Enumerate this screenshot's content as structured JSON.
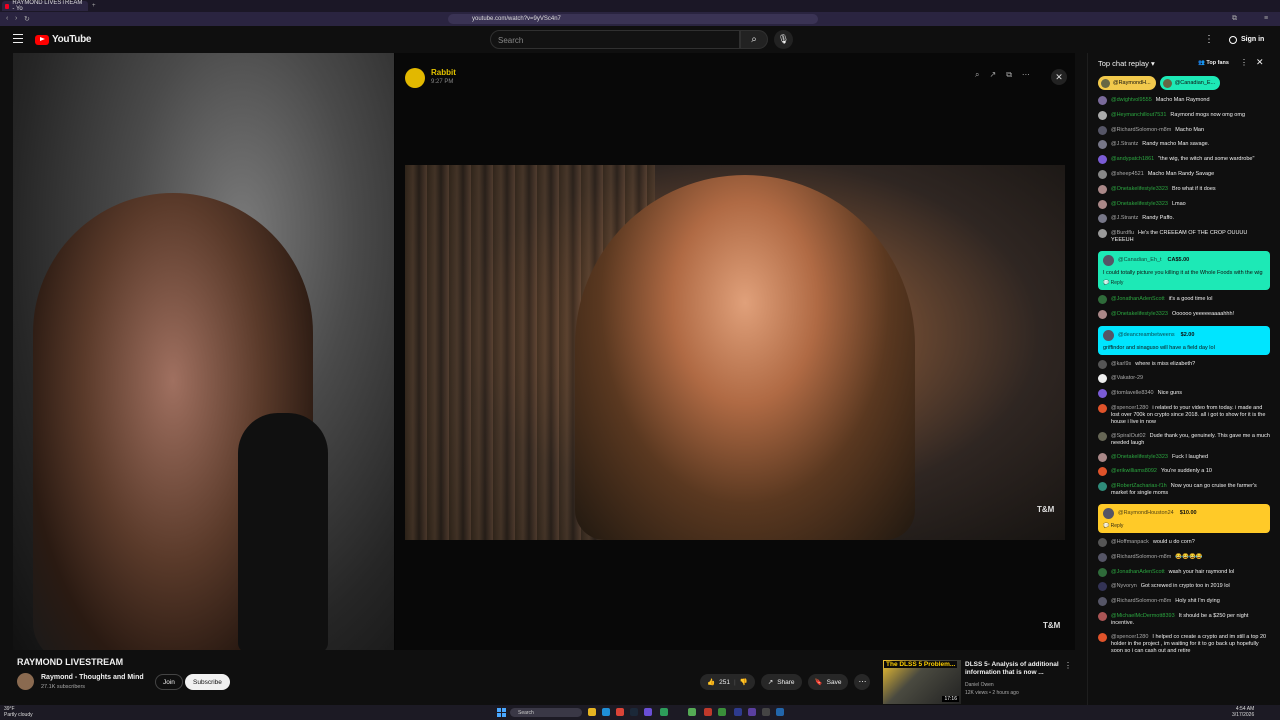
{
  "browser": {
    "tab_title": "RAYMOND LIVESTREAM - Yo",
    "url": "youtube.com/watch?v=9yVSc4n7"
  },
  "header": {
    "logo_text": "YouTube",
    "search_placeholder": "Search",
    "signin_label": "Sign in"
  },
  "inner_video": {
    "channel": "Rabbit",
    "time": "9:27 PM",
    "watermark": "T&M"
  },
  "video": {
    "title": "RAYMOND LIVESTREAM",
    "channel": "Raymond - Thoughts and Mind",
    "subscribers": "27.1K subscribers",
    "join_label": "Join",
    "subscribe_label": "Subscribe",
    "likes": "251",
    "share_label": "Share",
    "save_label": "Save"
  },
  "recommended": {
    "thumb_text": "The DLSS 5 Problem...",
    "duration": "17:16",
    "title": "DLSS 5- Analysis of additional information that is now ...",
    "channel": "Daniel Owen",
    "meta": "12K views • 2 hours ago"
  },
  "chat": {
    "title": "Top chat replay",
    "top_fans": "Top fans",
    "pinned": [
      {
        "label": "@RaymondH...",
        "color": "#f2c94c"
      },
      {
        "label": "@Canadian_E...",
        "color": "#1de9b6"
      }
    ],
    "messages": [
      {
        "author": "@dwightvol9555",
        "text": "Macho Man Raymond",
        "color": "#7a6a9a"
      },
      {
        "author": "@Heymanchillout7531",
        "text": "Raymond mogs now omg omg",
        "color": "#aaa"
      },
      {
        "author": "@RichardSolomon-m8m",
        "text": "Macho Man",
        "color": "#556",
        "gray": true
      },
      {
        "author": "@J.Strantz",
        "text": "Randy macho Man savage.",
        "color": "#778",
        "gray": true
      },
      {
        "author": "@andypatch1861",
        "text": "\"the wig, the witch and some wardrobe\"",
        "color": "#7b5cd6"
      },
      {
        "author": "@sheep4521",
        "text": "Macho Man Randy Savage",
        "color": "#888",
        "gray": true
      },
      {
        "author": "@Onetakelifestyle3323",
        "text": "Bro what if it does",
        "color": "#a88",
        "gray": false
      },
      {
        "author": "@Onetakelifestyle3323",
        "text": "Lmao",
        "color": "#a88"
      },
      {
        "author": "@J.Strantz",
        "text": "Randy Paffo.",
        "color": "#778",
        "gray": true
      },
      {
        "author": "@Burdflu",
        "text": "He's the CREEEAM OF THE CROP OUUUU YEEEUH",
        "color": "#999",
        "gray": true
      }
    ],
    "superchat1": {
      "name": "@Canadian_Eh_t",
      "amount": "CA$5.00",
      "text": "I could totally picture you killing it at the Whole Foods with the wig",
      "reply": "Reply"
    },
    "messages2": [
      {
        "author": "@JonathanAdenScott",
        "text": "it's a good time lol",
        "color": "#2f6b3a"
      },
      {
        "author": "@Onetakelifestyle3323",
        "text": "Oooooo yeeeeeaaaahhh!",
        "color": "#a88"
      }
    ],
    "superchat2": {
      "name": "@deancreambetweens",
      "amount": "$2.00",
      "text": "griffindor and sinaguso will have a field day lol"
    },
    "messages3": [
      {
        "author": "@karl9s",
        "text": "where is miss elizabeth?",
        "color": "#555",
        "gray": true
      },
      {
        "author": "@Vakator-29",
        "text": "",
        "color": "#eee",
        "gray": true
      },
      {
        "author": "@tomlavelle8340",
        "text": "Nice guns",
        "color": "#7b5cd6",
        "gray": true
      },
      {
        "author": "@spencer1280",
        "text": "i related to your video from today. i made and lost over 700k on crypto since 2018. all i got to show for it is the house i live in now",
        "color": "#e0532a",
        "gray": true
      },
      {
        "author": "@SpiralOut02",
        "text": "Dude thank you, genuinely. This gave me a much needed laugh",
        "color": "#665",
        "gray": true
      },
      {
        "author": "@Onetakelifestyle3323",
        "text": "Fuck I laughed",
        "color": "#a88"
      },
      {
        "author": "@erikwilliams8092",
        "text": "You're suddenly a 10",
        "color": "#e0532a"
      },
      {
        "author": "@RobertZacharias-f1h",
        "text": "Now you can go cruise the farmer's market for single moms",
        "color": "#2f8c7a"
      }
    ],
    "superchat3": {
      "name": "@RaymondHouston24",
      "amount": "$10.00",
      "reply": "Reply"
    },
    "messages4": [
      {
        "author": "@Hoffmanpack",
        "text": "would u do corn?",
        "color": "#555",
        "gray": true
      },
      {
        "author": "@RichardSolomon-m8m",
        "text": "😂😂😂😂",
        "color": "#556",
        "gray": true
      },
      {
        "author": "@JonathanAdenScott",
        "text": "wash your hair raymond lol",
        "color": "#2f6b3a"
      },
      {
        "author": "@Nyvoryn",
        "text": "Got screwed in crypto too in 2019 lol",
        "color": "#335",
        "gray": true
      },
      {
        "author": "@RichardSolomon-m8m",
        "text": "Holy shit I'm dying",
        "color": "#556",
        "gray": true
      },
      {
        "author": "@MichaelMcDermott8393",
        "text": "It should be a $250 per night incentive.",
        "color": "#a55"
      },
      {
        "author": "@spencer1280",
        "text": "I helped co create a crypto and im still a top 20 holder in the project , im waiting for it to go back up hopefully soon so i can cash out and retire",
        "color": "#e0532a",
        "gray": true
      }
    ]
  },
  "taskbar": {
    "weather_temp": "39°F",
    "weather_desc": "Partly cloudy",
    "search_label": "Search",
    "time": "4:54 AM",
    "date": "3/17/2026"
  },
  "colors": {
    "superchat_green": "#1de9b6",
    "superchat_cyan": "#00e5ff",
    "superchat_yellow": "#ffca28",
    "author_green": "#2ba640"
  }
}
